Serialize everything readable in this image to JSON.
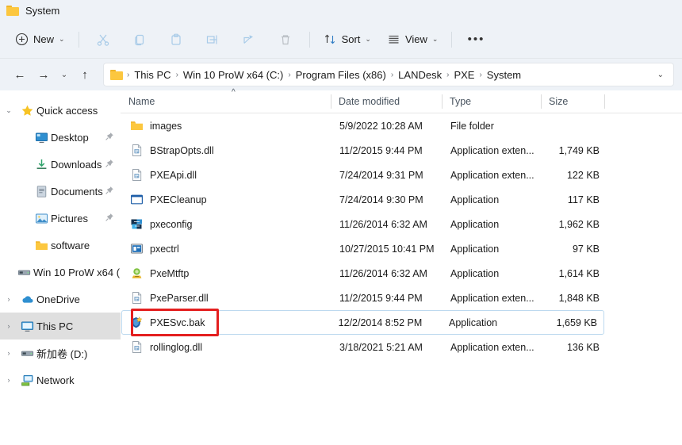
{
  "window": {
    "title": "System",
    "title_icon": "folder-icon"
  },
  "toolbar": {
    "new_label": "New",
    "sort_label": "Sort",
    "view_label": "View",
    "more_label": "See more",
    "items": [
      {
        "name": "cut-icon",
        "label": "Cut"
      },
      {
        "name": "copy-icon",
        "label": "Copy"
      },
      {
        "name": "paste-icon",
        "label": "Paste"
      },
      {
        "name": "rename-icon",
        "label": "Rename"
      },
      {
        "name": "share-icon",
        "label": "Share"
      },
      {
        "name": "delete-icon",
        "label": "Delete"
      }
    ]
  },
  "address": {
    "back": "←",
    "forward": "→",
    "recent": "⌄",
    "up": "↑",
    "crumbs": [
      "This PC",
      "Win 10 ProW x64 (C:)",
      "Program Files (x86)",
      "LANDesk",
      "PXE",
      "System"
    ],
    "separator": "›"
  },
  "sidebar": {
    "items": [
      {
        "label": "Quick access",
        "icon": "star-icon",
        "expander": "expanded",
        "indent": false,
        "pinned": false,
        "selected": false
      },
      {
        "label": "Desktop",
        "icon": "desktop-icon",
        "expander": "none",
        "indent": true,
        "pinned": true,
        "selected": false
      },
      {
        "label": "Downloads",
        "icon": "downloads-icon",
        "expander": "none",
        "indent": true,
        "pinned": true,
        "selected": false
      },
      {
        "label": "Documents",
        "icon": "documents-icon",
        "expander": "none",
        "indent": true,
        "pinned": true,
        "selected": false
      },
      {
        "label": "Pictures",
        "icon": "pictures-icon",
        "expander": "none",
        "indent": true,
        "pinned": true,
        "selected": false
      },
      {
        "label": "software",
        "icon": "folder-icon",
        "expander": "none",
        "indent": true,
        "pinned": false,
        "selected": false
      },
      {
        "label": "Win 10 ProW x64 (",
        "icon": "drive-icon",
        "expander": "none",
        "indent": true,
        "pinned": false,
        "selected": false
      },
      {
        "label": "OneDrive",
        "icon": "onedrive-icon",
        "expander": "collapsed",
        "indent": false,
        "pinned": false,
        "selected": false
      },
      {
        "label": "This PC",
        "icon": "thispc-icon",
        "expander": "collapsed",
        "indent": false,
        "pinned": false,
        "selected": true
      },
      {
        "label": "新加卷 (D:)",
        "icon": "drive-icon",
        "expander": "collapsed",
        "indent": false,
        "pinned": false,
        "selected": false
      },
      {
        "label": "Network",
        "icon": "network-icon",
        "expander": "collapsed",
        "indent": false,
        "pinned": false,
        "selected": false
      }
    ]
  },
  "filelist": {
    "columns": {
      "name": "Name",
      "date": "Date modified",
      "type": "Type",
      "size": "Size"
    },
    "sort_indicator": "^",
    "rows": [
      {
        "name": "images",
        "date": "5/9/2022 10:28 AM",
        "type": "File folder",
        "size": "",
        "icon": "folder-icon",
        "selected": false
      },
      {
        "name": "BStrapOpts.dll",
        "date": "11/2/2015 9:44 PM",
        "type": "Application exten...",
        "size": "1,749 KB",
        "icon": "dll-icon",
        "selected": false
      },
      {
        "name": "PXEApi.dll",
        "date": "7/24/2014 9:31 PM",
        "type": "Application exten...",
        "size": "122 KB",
        "icon": "dll-icon",
        "selected": false
      },
      {
        "name": "PXECleanup",
        "date": "7/24/2014 9:30 PM",
        "type": "Application",
        "size": "117 KB",
        "icon": "window-app-icon",
        "selected": false
      },
      {
        "name": "pxeconfig",
        "date": "11/26/2014 6:32 AM",
        "type": "Application",
        "size": "1,962 KB",
        "icon": "pxeconfig-icon",
        "selected": false
      },
      {
        "name": "pxectrl",
        "date": "10/27/2015 10:41 PM",
        "type": "Application",
        "size": "97 KB",
        "icon": "pxectrl-icon",
        "selected": false
      },
      {
        "name": "PxeMtftp",
        "date": "11/26/2014 6:32 AM",
        "type": "Application",
        "size": "1,614 KB",
        "icon": "pxemtftp-icon",
        "selected": false
      },
      {
        "name": "PxeParser.dll",
        "date": "11/2/2015 9:44 PM",
        "type": "Application exten...",
        "size": "1,848 KB",
        "icon": "dll-icon",
        "selected": false
      },
      {
        "name": "PXESvc.bak",
        "date": "12/2/2014 8:52 PM",
        "type": "Application",
        "size": "1,659 KB",
        "icon": "pxesvc-icon",
        "selected": true
      },
      {
        "name": "rollinglog.dll",
        "date": "3/18/2021 5:21 AM",
        "type": "Application exten...",
        "size": "136 KB",
        "icon": "dll-icon",
        "selected": false
      }
    ]
  },
  "annotation": {
    "highlight_color": "#e41f1f",
    "target": "PXESvc.bak"
  },
  "colors": {
    "chrome_bg": "#eef2f7",
    "content_bg": "#ffffff",
    "selection_border": "#bcd9ef",
    "nav_selected_bg": "#dfdfdf",
    "folder_yellow": "#fcc73f",
    "accent_blue": "#0f6cbd"
  }
}
